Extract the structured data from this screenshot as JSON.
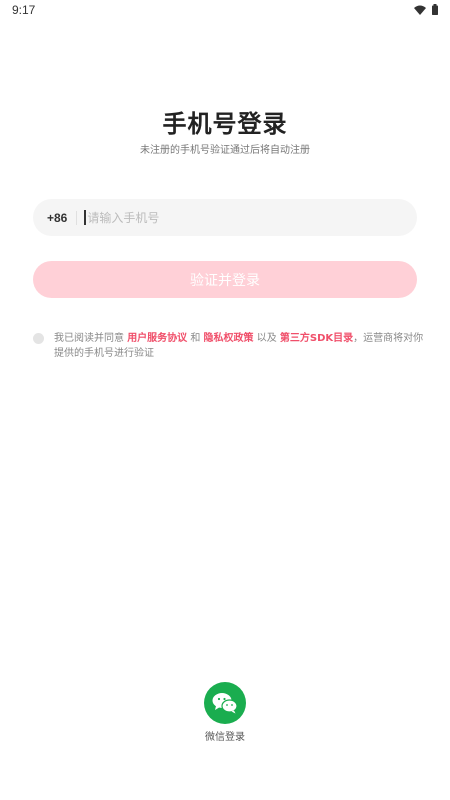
{
  "status_bar": {
    "time": "9:17"
  },
  "login": {
    "title": "手机号登录",
    "subtitle": "未注册的手机号验证通过后将自动注册",
    "country_code": "+86",
    "phone_placeholder": "请输入手机号",
    "phone_value": "",
    "submit_label": "验证并登录"
  },
  "agreement": {
    "prefix": "我已阅读并同意 ",
    "user_agreement": "用户服务协议",
    "and": " 和 ",
    "privacy_policy": "隐私权政策",
    "also": " 以及 ",
    "sdk_list": "第三方SDK目录",
    "suffix": "，运营商将对你提供的手机号进行验证"
  },
  "wechat": {
    "label": "微信登录"
  },
  "colors": {
    "accent": "#f04f6a",
    "button_disabled": "#ffd0d7",
    "wechat": "#1aad4f"
  }
}
